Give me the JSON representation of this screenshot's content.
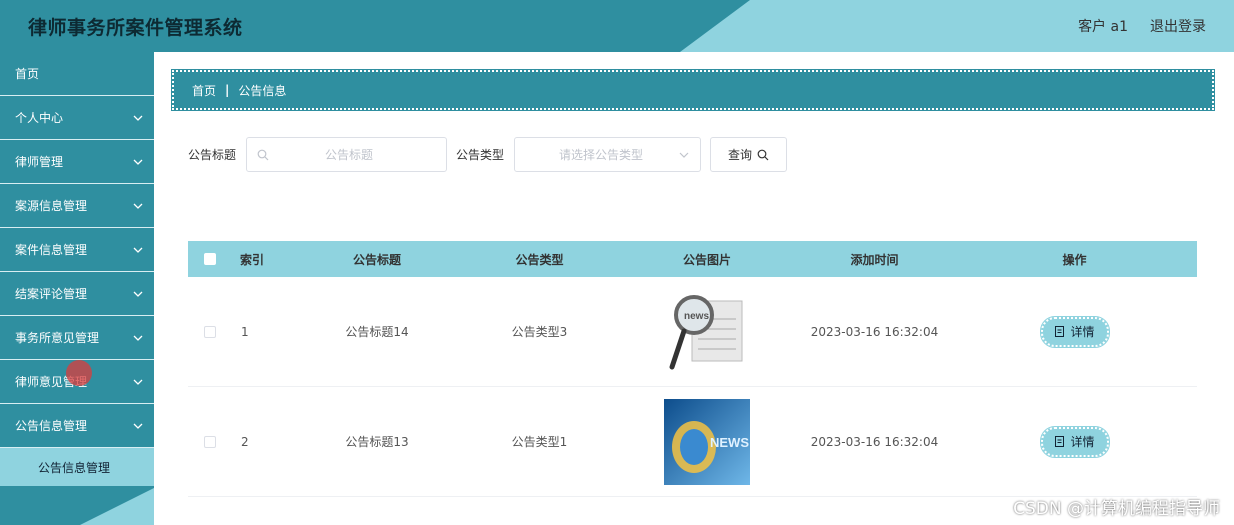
{
  "header": {
    "title": "律师事务所案件管理系统",
    "user_label": "客户 a1",
    "logout_label": "退出登录"
  },
  "sidebar": {
    "items": [
      {
        "label": "首页",
        "has_chevron": false
      },
      {
        "label": "个人中心",
        "has_chevron": true
      },
      {
        "label": "律师管理",
        "has_chevron": true
      },
      {
        "label": "案源信息管理",
        "has_chevron": true
      },
      {
        "label": "案件信息管理",
        "has_chevron": true
      },
      {
        "label": "结案评论管理",
        "has_chevron": true
      },
      {
        "label": "事务所意见管理",
        "has_chevron": true
      },
      {
        "label": "律师意见管理",
        "has_chevron": true
      },
      {
        "label": "公告信息管理",
        "has_chevron": true,
        "expanded": true
      }
    ],
    "submenu": {
      "label": "公告信息管理"
    }
  },
  "breadcrumb": {
    "home": "首页",
    "separator": "|",
    "current": "公告信息"
  },
  "search": {
    "title_label": "公告标题",
    "title_placeholder": "公告标题",
    "type_label": "公告类型",
    "type_placeholder": "请选择公告类型",
    "query_label": "查询"
  },
  "table": {
    "headers": {
      "index": "索引",
      "title": "公告标题",
      "type": "公告类型",
      "image": "公告图片",
      "time": "添加时间",
      "op": "操作"
    },
    "rows": [
      {
        "index": "1",
        "title": "公告标题14",
        "type": "公告类型3",
        "image_icon": "news-magnifier-image",
        "time": "2023-03-16 16:32:04",
        "detail_label": "详情"
      },
      {
        "index": "2",
        "title": "公告标题13",
        "type": "公告类型1",
        "image_icon": "news-blue-image",
        "time": "2023-03-16 16:32:04",
        "detail_label": "详情"
      }
    ]
  },
  "watermark": "CSDN @计算机编程指导师",
  "colors": {
    "primary": "#2f8fa0",
    "accent": "#8fd3df"
  }
}
